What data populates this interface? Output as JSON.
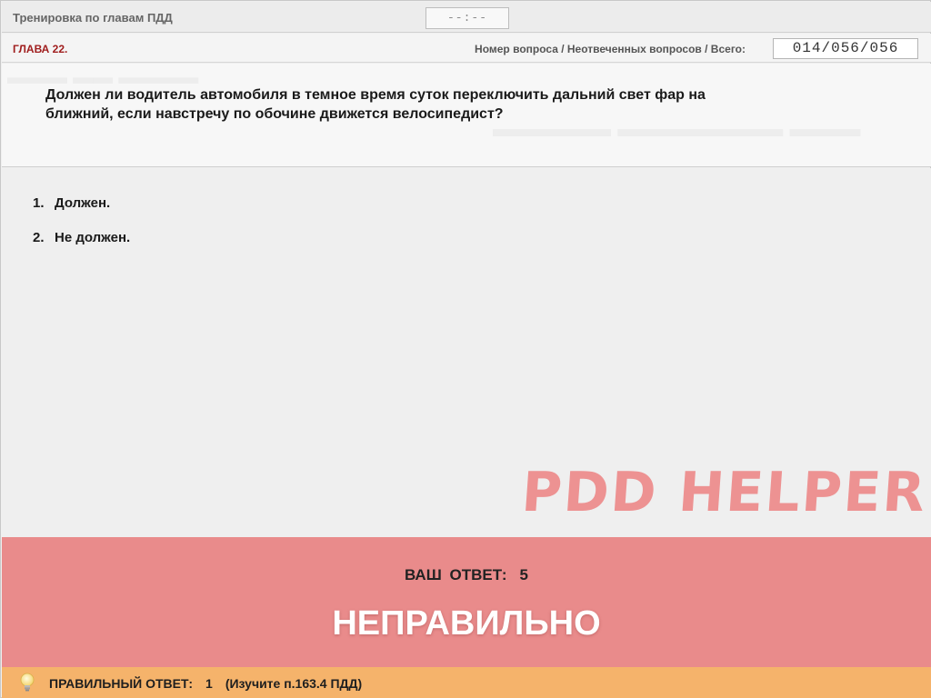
{
  "header": {
    "mode_title": "Тренировка по главам ПДД",
    "timer": "--:--"
  },
  "info": {
    "chapter": "ГЛАВА 22.",
    "counter_label": "Номер вопроса / Неотвеченных вопросов / Всего:",
    "counter_value": "014/056/056"
  },
  "question": {
    "text": "Должен ли водитель автомобиля в темное время суток переключить дальний свет фар на ближний, если навстречу по обочине движется велосипедист?"
  },
  "answers": [
    {
      "number": "1.",
      "text": "Должен."
    },
    {
      "number": "2.",
      "text": "Не должен."
    }
  ],
  "watermark": "PDD HELPER",
  "result": {
    "your_answer_label": "ВАШ ОТВЕТ:",
    "your_answer_value": "5",
    "verdict": "НЕПРАВИЛЬНО"
  },
  "hint": {
    "label": "ПРАВИЛЬНЫЙ ОТВЕТ:",
    "value": "1",
    "note": "(Изучите п.163.4 ПДД)",
    "icon": "lightbulb-icon"
  },
  "colors": {
    "chapter": "#a01e1e",
    "result_bg": "#e98b8b",
    "hint_bg": "#f5b36b",
    "watermark": "#ec6e6e"
  }
}
